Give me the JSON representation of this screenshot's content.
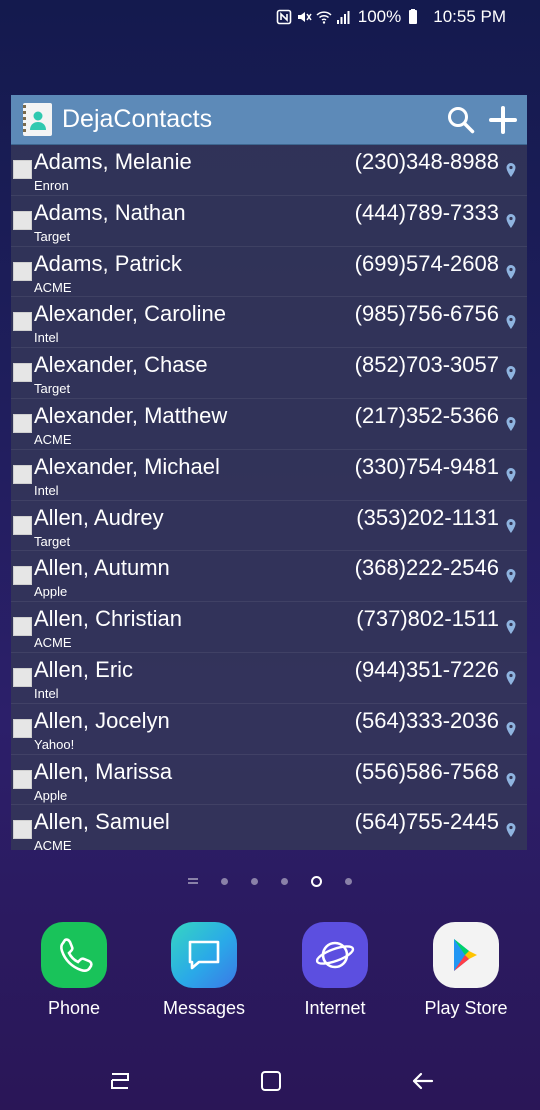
{
  "status_bar": {
    "battery_percent": "100%",
    "time": "10:55 PM",
    "icons": [
      "nfc-icon",
      "mute-icon",
      "wifi-icon",
      "signal-icon",
      "battery-icon"
    ]
  },
  "widget": {
    "title": "DejaContacts",
    "header_color": "#5d8ab8",
    "actions": [
      "search-icon",
      "add-icon"
    ],
    "contacts": [
      {
        "name": "Adams, Melanie",
        "company": "Enron",
        "phone": "(230)348-8988"
      },
      {
        "name": "Adams, Nathan",
        "company": "Target",
        "phone": "(444)789-7333"
      },
      {
        "name": "Adams, Patrick",
        "company": "ACME",
        "phone": "(699)574-2608"
      },
      {
        "name": "Alexander, Caroline",
        "company": "Intel",
        "phone": "(985)756-6756"
      },
      {
        "name": "Alexander, Chase",
        "company": "Target",
        "phone": "(852)703-3057"
      },
      {
        "name": "Alexander, Matthew",
        "company": "ACME",
        "phone": "(217)352-5366"
      },
      {
        "name": "Alexander, Michael",
        "company": "Intel",
        "phone": "(330)754-9481"
      },
      {
        "name": "Allen, Audrey",
        "company": "Target",
        "phone": "(353)202-1131"
      },
      {
        "name": "Allen, Autumn",
        "company": "Apple",
        "phone": "(368)222-2546"
      },
      {
        "name": "Allen, Christian",
        "company": "ACME",
        "phone": "(737)802-1511"
      },
      {
        "name": "Allen, Eric",
        "company": "Intel",
        "phone": "(944)351-7226"
      },
      {
        "name": "Allen, Jocelyn",
        "company": "Yahoo!",
        "phone": "(564)333-2036"
      },
      {
        "name": "Allen, Marissa",
        "company": "Apple",
        "phone": "(556)586-7568"
      },
      {
        "name": "Allen, Samuel",
        "company": "ACME",
        "phone": "(564)755-2445"
      }
    ]
  },
  "page_indicator": {
    "page_count": 5,
    "current_page": 4
  },
  "dock": {
    "apps": [
      {
        "label": "Phone",
        "icon": "phone-icon",
        "color": "#19c35a"
      },
      {
        "label": "Messages",
        "icon": "messages-icon",
        "color": "#2aa9e8"
      },
      {
        "label": "Internet",
        "icon": "internet-icon",
        "color": "#5c4fe0"
      },
      {
        "label": "Play Store",
        "icon": "play-store-icon",
        "color": "#f3f3f3"
      }
    ]
  },
  "nav_bar": {
    "buttons": [
      "recents-icon",
      "home-icon",
      "back-icon"
    ]
  }
}
